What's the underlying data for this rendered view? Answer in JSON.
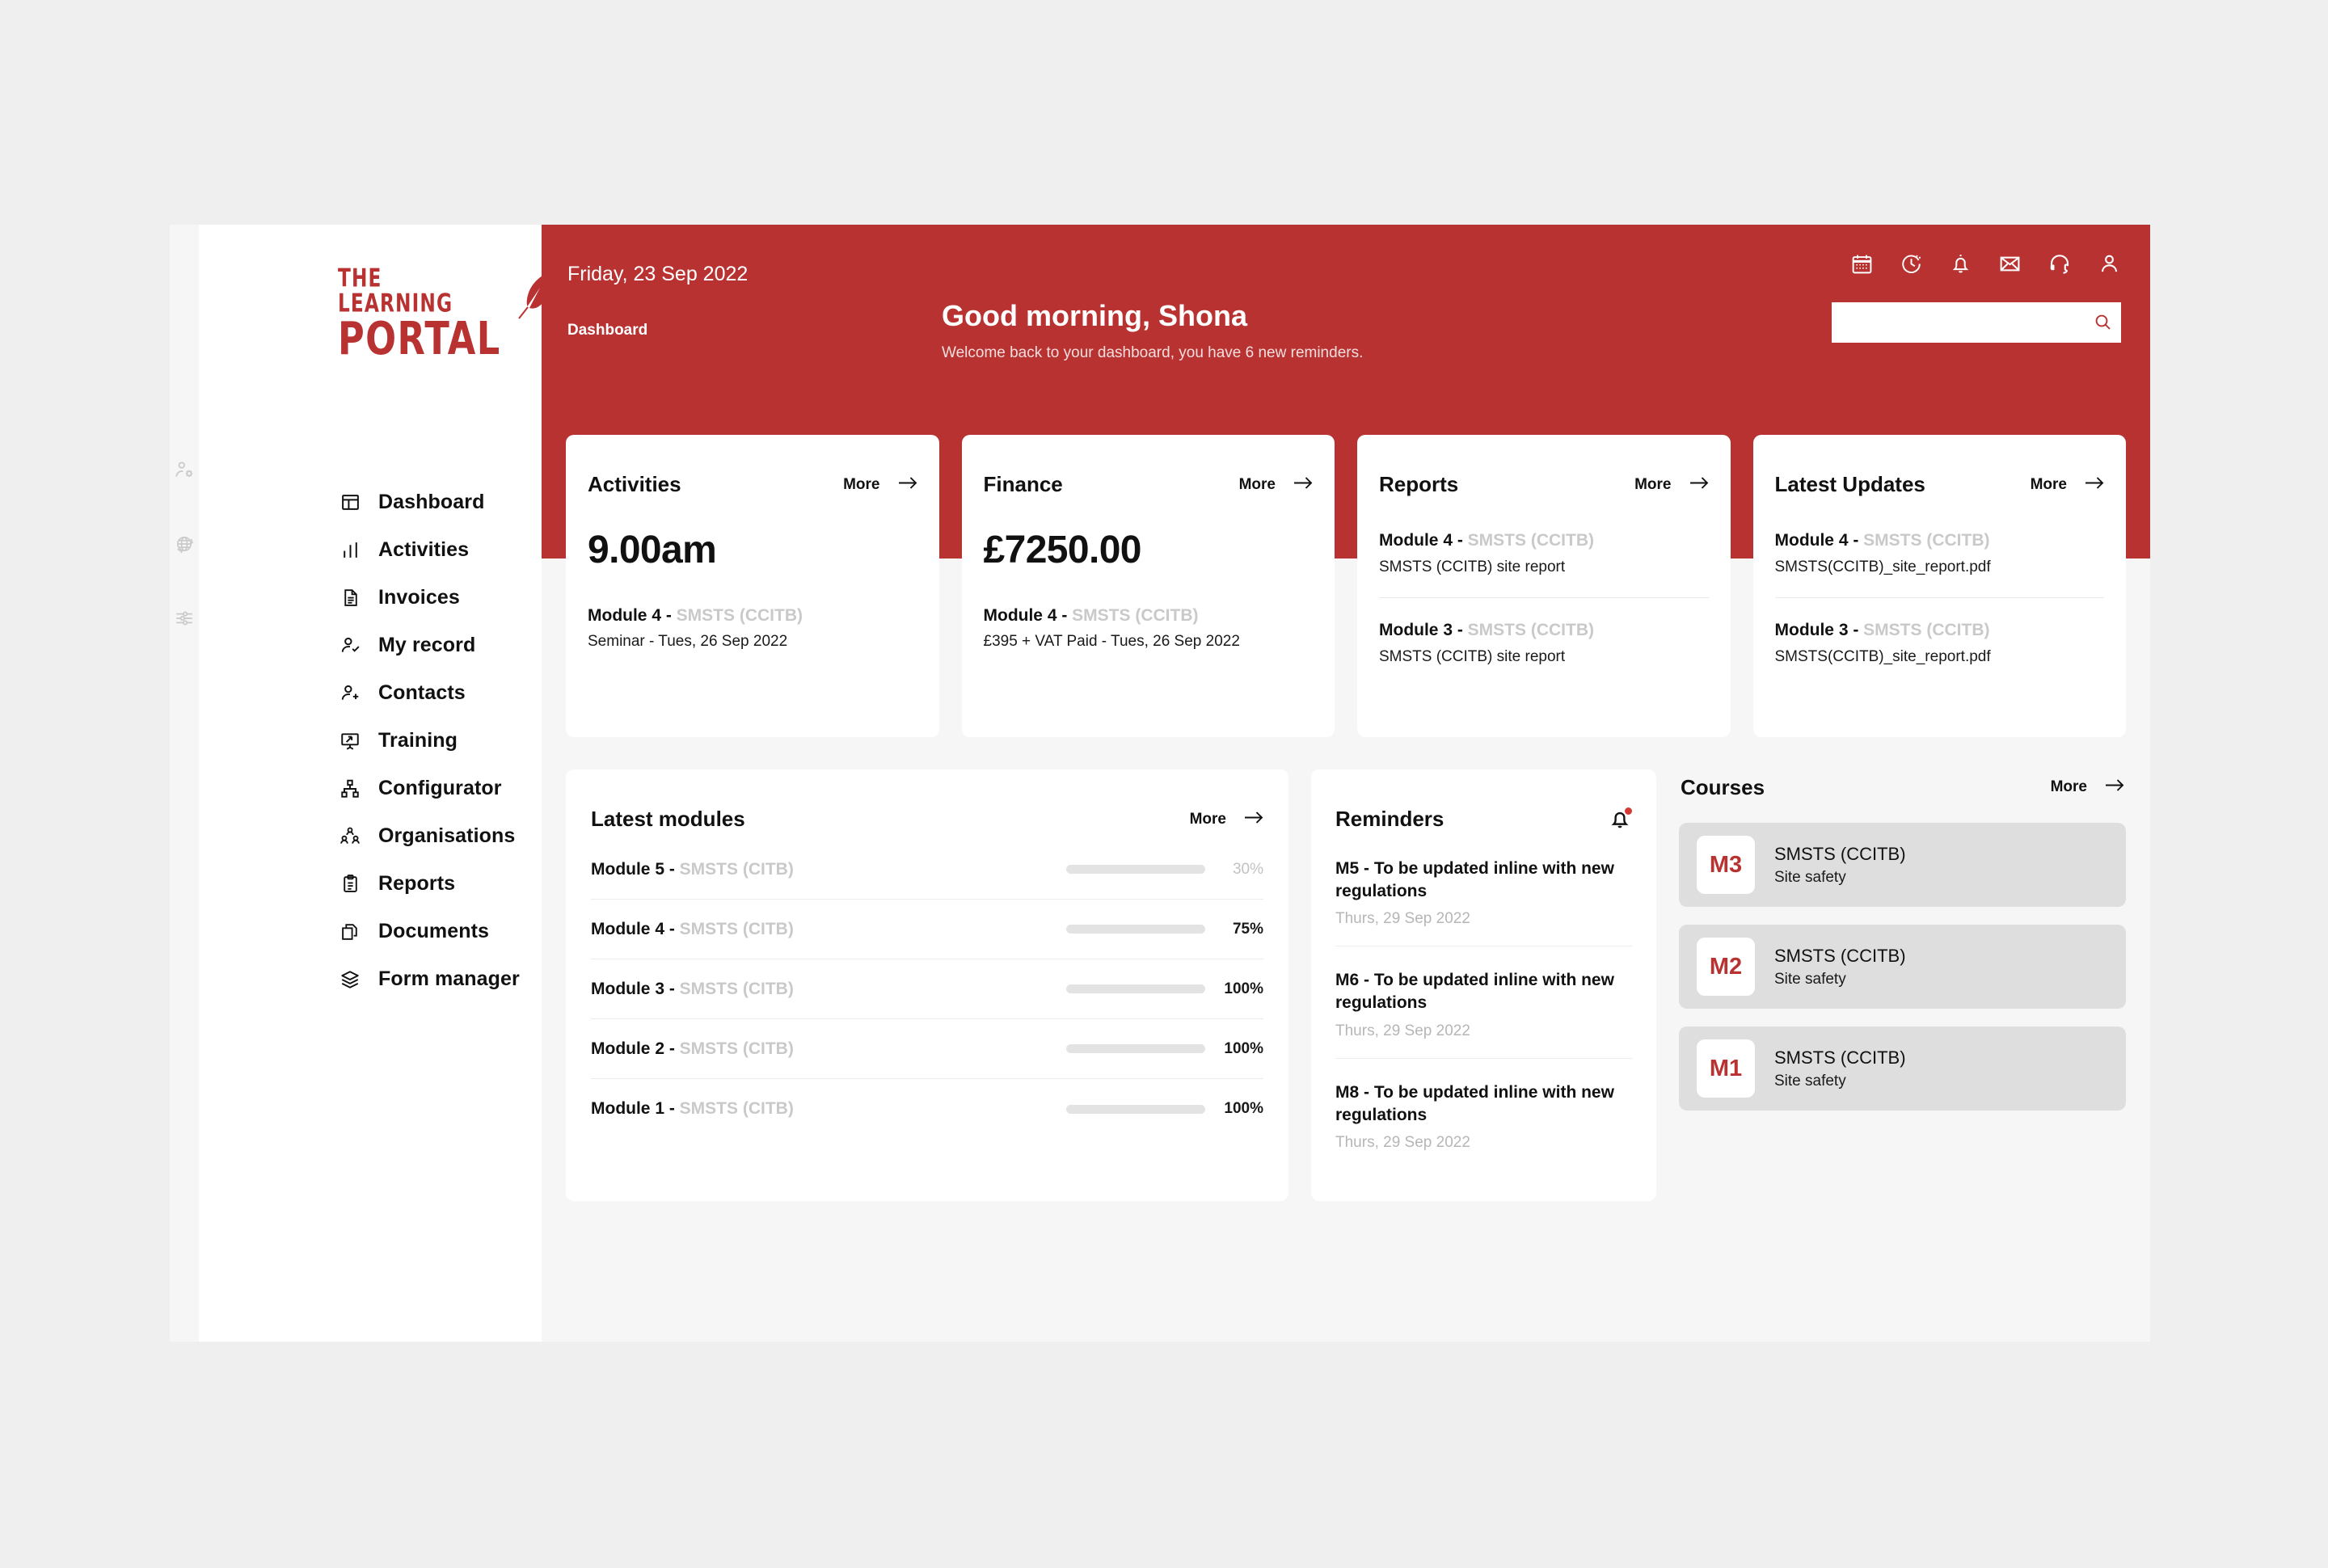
{
  "brand": {
    "red": "#b93232",
    "muted_grey": "#c9c9c9",
    "page_bg": "#efefef"
  },
  "logo": {
    "line1": "THE LEARNING",
    "line2": "PORTAL",
    "tm": "™"
  },
  "edge_rail": {
    "icons": [
      "user-settings-icon",
      "globe-refresh-icon",
      "sliders-icon"
    ]
  },
  "sidebar": {
    "items": [
      {
        "label": "Dashboard",
        "icon": "layout-dashboard-icon",
        "active": true
      },
      {
        "label": "Activities",
        "icon": "bar-chart-icon",
        "active": false
      },
      {
        "label": "Invoices",
        "icon": "document-lines-icon",
        "active": false
      },
      {
        "label": "My record",
        "icon": "user-check-icon",
        "active": false
      },
      {
        "label": "Contacts",
        "icon": "user-plus-icon",
        "active": false
      },
      {
        "label": "Training",
        "icon": "presentation-icon",
        "active": false
      },
      {
        "label": "Configurator",
        "icon": "sitemap-icon",
        "active": false
      },
      {
        "label": "Organisations",
        "icon": "users-group-icon",
        "active": false
      },
      {
        "label": "Reports",
        "icon": "clipboard-lines-icon",
        "active": false
      },
      {
        "label": "Documents",
        "icon": "copy-stack-icon",
        "active": false
      },
      {
        "label": "Form manager",
        "icon": "layers-icon",
        "active": false
      }
    ]
  },
  "header": {
    "date": "Friday, 23 Sep 2022",
    "breadcrumb": "Dashboard",
    "greeting": "Good morning, Shona",
    "subtitle": "Welcome back to your dashboard, you have 6 new reminders.",
    "icons": [
      "calendar-icon",
      "timer-icon",
      "bell-icon",
      "mail-icon",
      "headset-icon",
      "user-icon"
    ],
    "search": {
      "value": "",
      "placeholder": "",
      "icon": "search-icon"
    }
  },
  "cards": {
    "activities": {
      "title": "Activities",
      "more": "More",
      "stat": "9.00am",
      "item_title_bold": "Module 4 - ",
      "item_title_muted": "SMSTS (CCITB)",
      "item_sub": "Seminar - Tues, 26 Sep 2022"
    },
    "finance": {
      "title": "Finance",
      "more": "More",
      "stat": "£7250.00",
      "item_title_bold": "Module 4 - ",
      "item_title_muted": "SMSTS (CCITB)",
      "item_sub": "£395 + VAT Paid - Tues, 26 Sep 2022"
    },
    "reports": {
      "title": "Reports",
      "more": "More",
      "entries": [
        {
          "bold": "Module 4 - ",
          "muted": "SMSTS (CCITB)",
          "sub": "SMSTS (CCITB) site report"
        },
        {
          "bold": "Module 3 - ",
          "muted": "SMSTS (CCITB)",
          "sub": "SMSTS (CCITB) site report"
        }
      ]
    },
    "latest_updates": {
      "title": "Latest Updates",
      "more": "More",
      "entries": [
        {
          "bold": "Module 4 - ",
          "muted": "SMSTS (CCITB)",
          "sub": "SMSTS(CCITB)_site_report.pdf"
        },
        {
          "bold": "Module 3 - ",
          "muted": "SMSTS (CCITB)",
          "sub": "SMSTS(CCITB)_site_report.pdf"
        }
      ]
    },
    "latest_modules": {
      "title": "Latest modules",
      "more": "More",
      "rows": [
        {
          "bold": "Module 5 - ",
          "muted": "SMSTS (CITB)",
          "percent_label": "30%",
          "percent": 30,
          "dim": true
        },
        {
          "bold": "Module 4 - ",
          "muted": "SMSTS (CITB)",
          "percent_label": "75%",
          "percent": 75,
          "dim": false
        },
        {
          "bold": "Module 3 - ",
          "muted": "SMSTS (CITB)",
          "percent_label": "100%",
          "percent": 100,
          "dim": false
        },
        {
          "bold": "Module 2 - ",
          "muted": "SMSTS (CITB)",
          "percent_label": "100%",
          "percent": 100,
          "dim": false
        },
        {
          "bold": "Module 1 - ",
          "muted": "SMSTS (CITB)",
          "percent_label": "100%",
          "percent": 100,
          "dim": false
        }
      ]
    },
    "reminders": {
      "title": "Reminders",
      "icon": "bell-notification-icon",
      "items": [
        {
          "text": "M5 - To be updated inline with new regulations",
          "date": "Thurs, 29 Sep 2022"
        },
        {
          "text": "M6 - To be updated inline with new regulations",
          "date": "Thurs, 29 Sep 2022"
        },
        {
          "text": "M8 - To be updated inline with new regulations",
          "date": "Thurs, 29 Sep 2022"
        }
      ]
    },
    "courses": {
      "title": "Courses",
      "more": "More",
      "items": [
        {
          "badge": "M3",
          "name": "SMSTS (CCITB)",
          "sub": "Site safety"
        },
        {
          "badge": "M2",
          "name": "SMSTS (CCITB)",
          "sub": "Site safety"
        },
        {
          "badge": "M1",
          "name": "SMSTS (CCITB)",
          "sub": "Site safety"
        }
      ]
    }
  }
}
